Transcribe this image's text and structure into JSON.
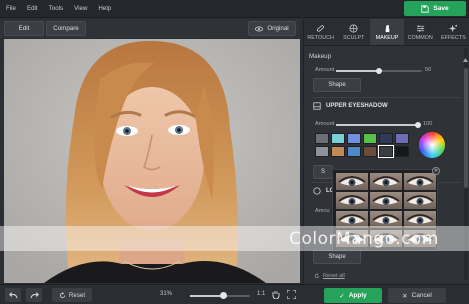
{
  "menu": [
    "File",
    "Edit",
    "Tools",
    "View",
    "Help"
  ],
  "save_label": "Save",
  "toolbar": {
    "edit_label": "Edit",
    "compare_label": "Compare",
    "original_label": "Original"
  },
  "tabs": [
    {
      "label": "RETOUCH",
      "icon": "bandage-icon"
    },
    {
      "label": "SCULPT",
      "icon": "globe-icon"
    },
    {
      "label": "MAKEUP",
      "icon": "lipstick-icon",
      "active": true
    },
    {
      "label": "COMMON",
      "icon": "sliders-icon"
    },
    {
      "label": "EFFECTS",
      "icon": "stars-icon"
    }
  ],
  "makeup": {
    "title": "Makeup",
    "amount_label": "Amount",
    "amount_value": "50",
    "amount_fraction": 0.5,
    "shape_label": "Shape"
  },
  "eyeshadow": {
    "title": "UPPER EYESHADOW",
    "amount_label": "Amount",
    "amount_value": "100",
    "amount_fraction": 1.0,
    "swatches": [
      "#6b6f77",
      "#79d0d9",
      "#6f8fe0",
      "#57c14c",
      "#2f3a5a",
      "#6c6fb8",
      "#8f9298",
      "#c38a55",
      "#4f89c8",
      "#6a4d3a",
      "#3a3c40",
      "#161718"
    ],
    "selected_index": 10
  },
  "lower": {
    "title_partial": "LO",
    "amount_label": "Amou",
    "shape_label": "Shape"
  },
  "reset_all_label": "Reset all",
  "bottom": {
    "reset_label": "Reset",
    "zoom_label": "31%",
    "zoom_fraction": 0.55,
    "ratio_label": "1:1",
    "apply_label": "Apply",
    "cancel_label": "Cancel"
  },
  "watermark_text": "ColorMango.com"
}
